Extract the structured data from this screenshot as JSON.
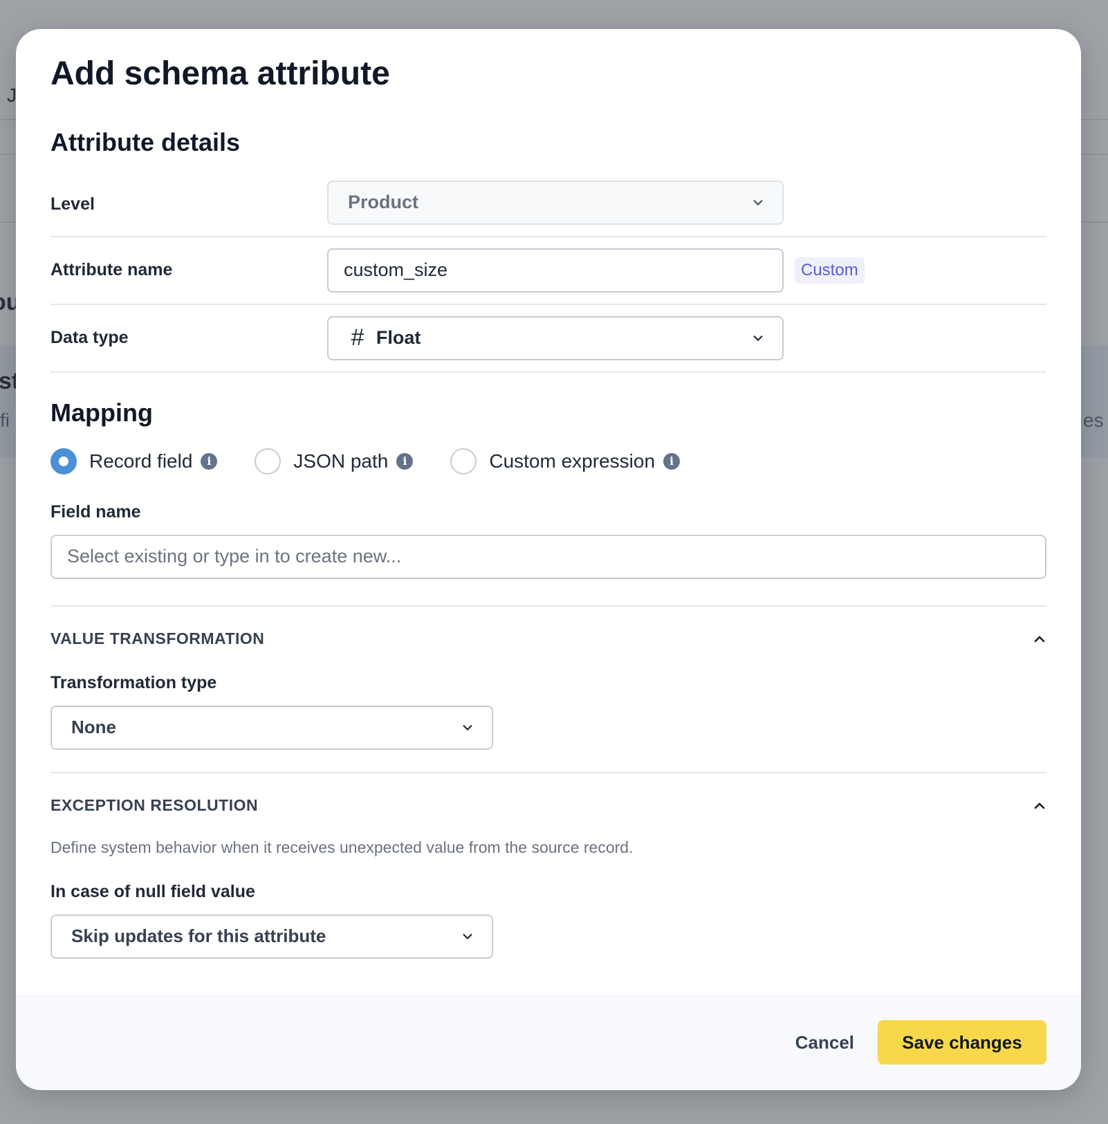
{
  "background": {
    "fragments": [
      "J",
      "ou",
      "st",
      "fi",
      "es"
    ]
  },
  "modal": {
    "title": "Add schema attribute",
    "details": {
      "section_title": "Attribute details",
      "level": {
        "label": "Level",
        "value": "Product",
        "icon": "chevron-down-icon"
      },
      "attribute_name": {
        "label": "Attribute name",
        "value": "custom_size",
        "badge": "Custom"
      },
      "data_type": {
        "label": "Data type",
        "value": "Float",
        "type_icon": "#",
        "icon": "chevron-down-icon"
      }
    },
    "mapping": {
      "section_title": "Mapping",
      "options": [
        {
          "label": "Record field",
          "checked": true
        },
        {
          "label": "JSON path",
          "checked": false
        },
        {
          "label": "Custom expression",
          "checked": false
        }
      ],
      "field_name": {
        "label": "Field name",
        "placeholder": "Select existing or type in to create new..."
      }
    },
    "value_transformation": {
      "title": "VALUE TRANSFORMATION",
      "type_label": "Transformation type",
      "type_value": "None"
    },
    "exception_resolution": {
      "title": "EXCEPTION RESOLUTION",
      "description": "Define system behavior when it receives unexpected value from the source record.",
      "null_label": "In case of null field value",
      "null_value": "Skip updates for this attribute"
    },
    "footer": {
      "cancel_label": "Cancel",
      "save_label": "Save changes",
      "save_color": "#f8d84a"
    }
  },
  "colors": {
    "accent_radio": "#4a90d6",
    "badge_text": "#5b5bd6",
    "badge_bg": "#eef0fb"
  }
}
